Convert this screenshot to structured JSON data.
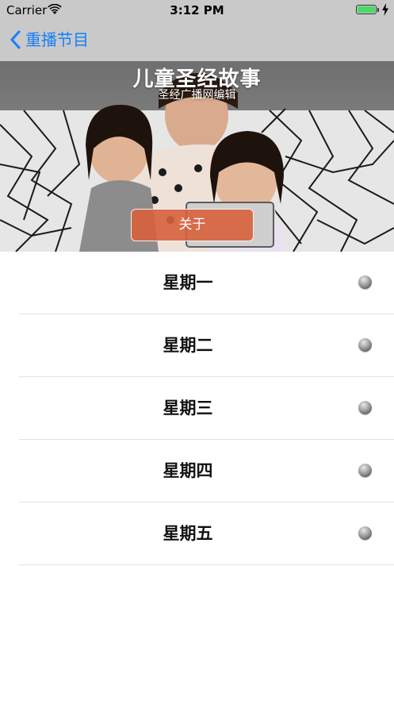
{
  "status_bar": {
    "carrier": "Carrier",
    "time": "3:12 PM",
    "battery_level": 1.0,
    "battery_color": "#4cd964"
  },
  "nav": {
    "back_label": "重播节目",
    "accent": "#157efb"
  },
  "hero": {
    "title": "儿童圣经故事",
    "subtitle": "圣经广播网编辑",
    "about_label": "关于",
    "about_color": "#d7603c"
  },
  "days": [
    {
      "label": "星期一"
    },
    {
      "label": "星期二"
    },
    {
      "label": "星期三"
    },
    {
      "label": "星期四"
    },
    {
      "label": "星期五"
    }
  ]
}
